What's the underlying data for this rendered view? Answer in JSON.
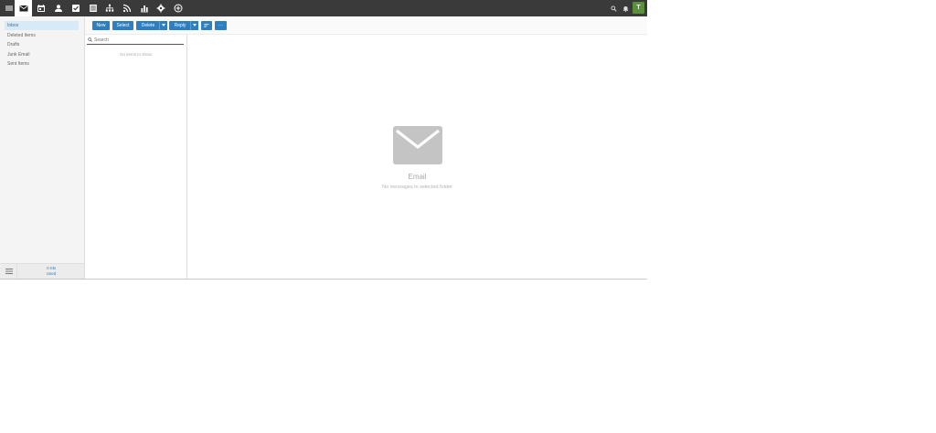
{
  "topbar": {
    "nav": [
      {
        "name": "menu-icon"
      },
      {
        "name": "mail-icon",
        "active": true
      },
      {
        "name": "calendar-icon"
      },
      {
        "name": "contacts-icon"
      },
      {
        "name": "tasks-icon"
      },
      {
        "name": "notes-icon"
      },
      {
        "name": "org-chart-icon"
      },
      {
        "name": "rss-icon"
      },
      {
        "name": "reports-icon"
      },
      {
        "name": "settings-icon"
      },
      {
        "name": "add-icon"
      }
    ],
    "user_initial": "T",
    "accent": "#5a8f3c"
  },
  "folders": [
    "Inbox",
    "Deleted Items",
    "Drafts",
    "Junk Email",
    "Sent Items"
  ],
  "selected_folder": "Inbox",
  "storage": {
    "line1": "0 KB",
    "line2": "Used"
  },
  "toolbar": {
    "new_label": "New",
    "select_label": "Select",
    "delete_label": "Delete",
    "reply_label": "Reply",
    "more_label": "···"
  },
  "search": {
    "placeholder": "Search"
  },
  "list": {
    "empty": "No items to show."
  },
  "reading": {
    "title": "Email",
    "subtitle": "No messages in selected folder"
  },
  "colors": {
    "primary": "#2d7fc1",
    "topbar": "#3a3a3a",
    "selected": "#d6eaf8"
  }
}
